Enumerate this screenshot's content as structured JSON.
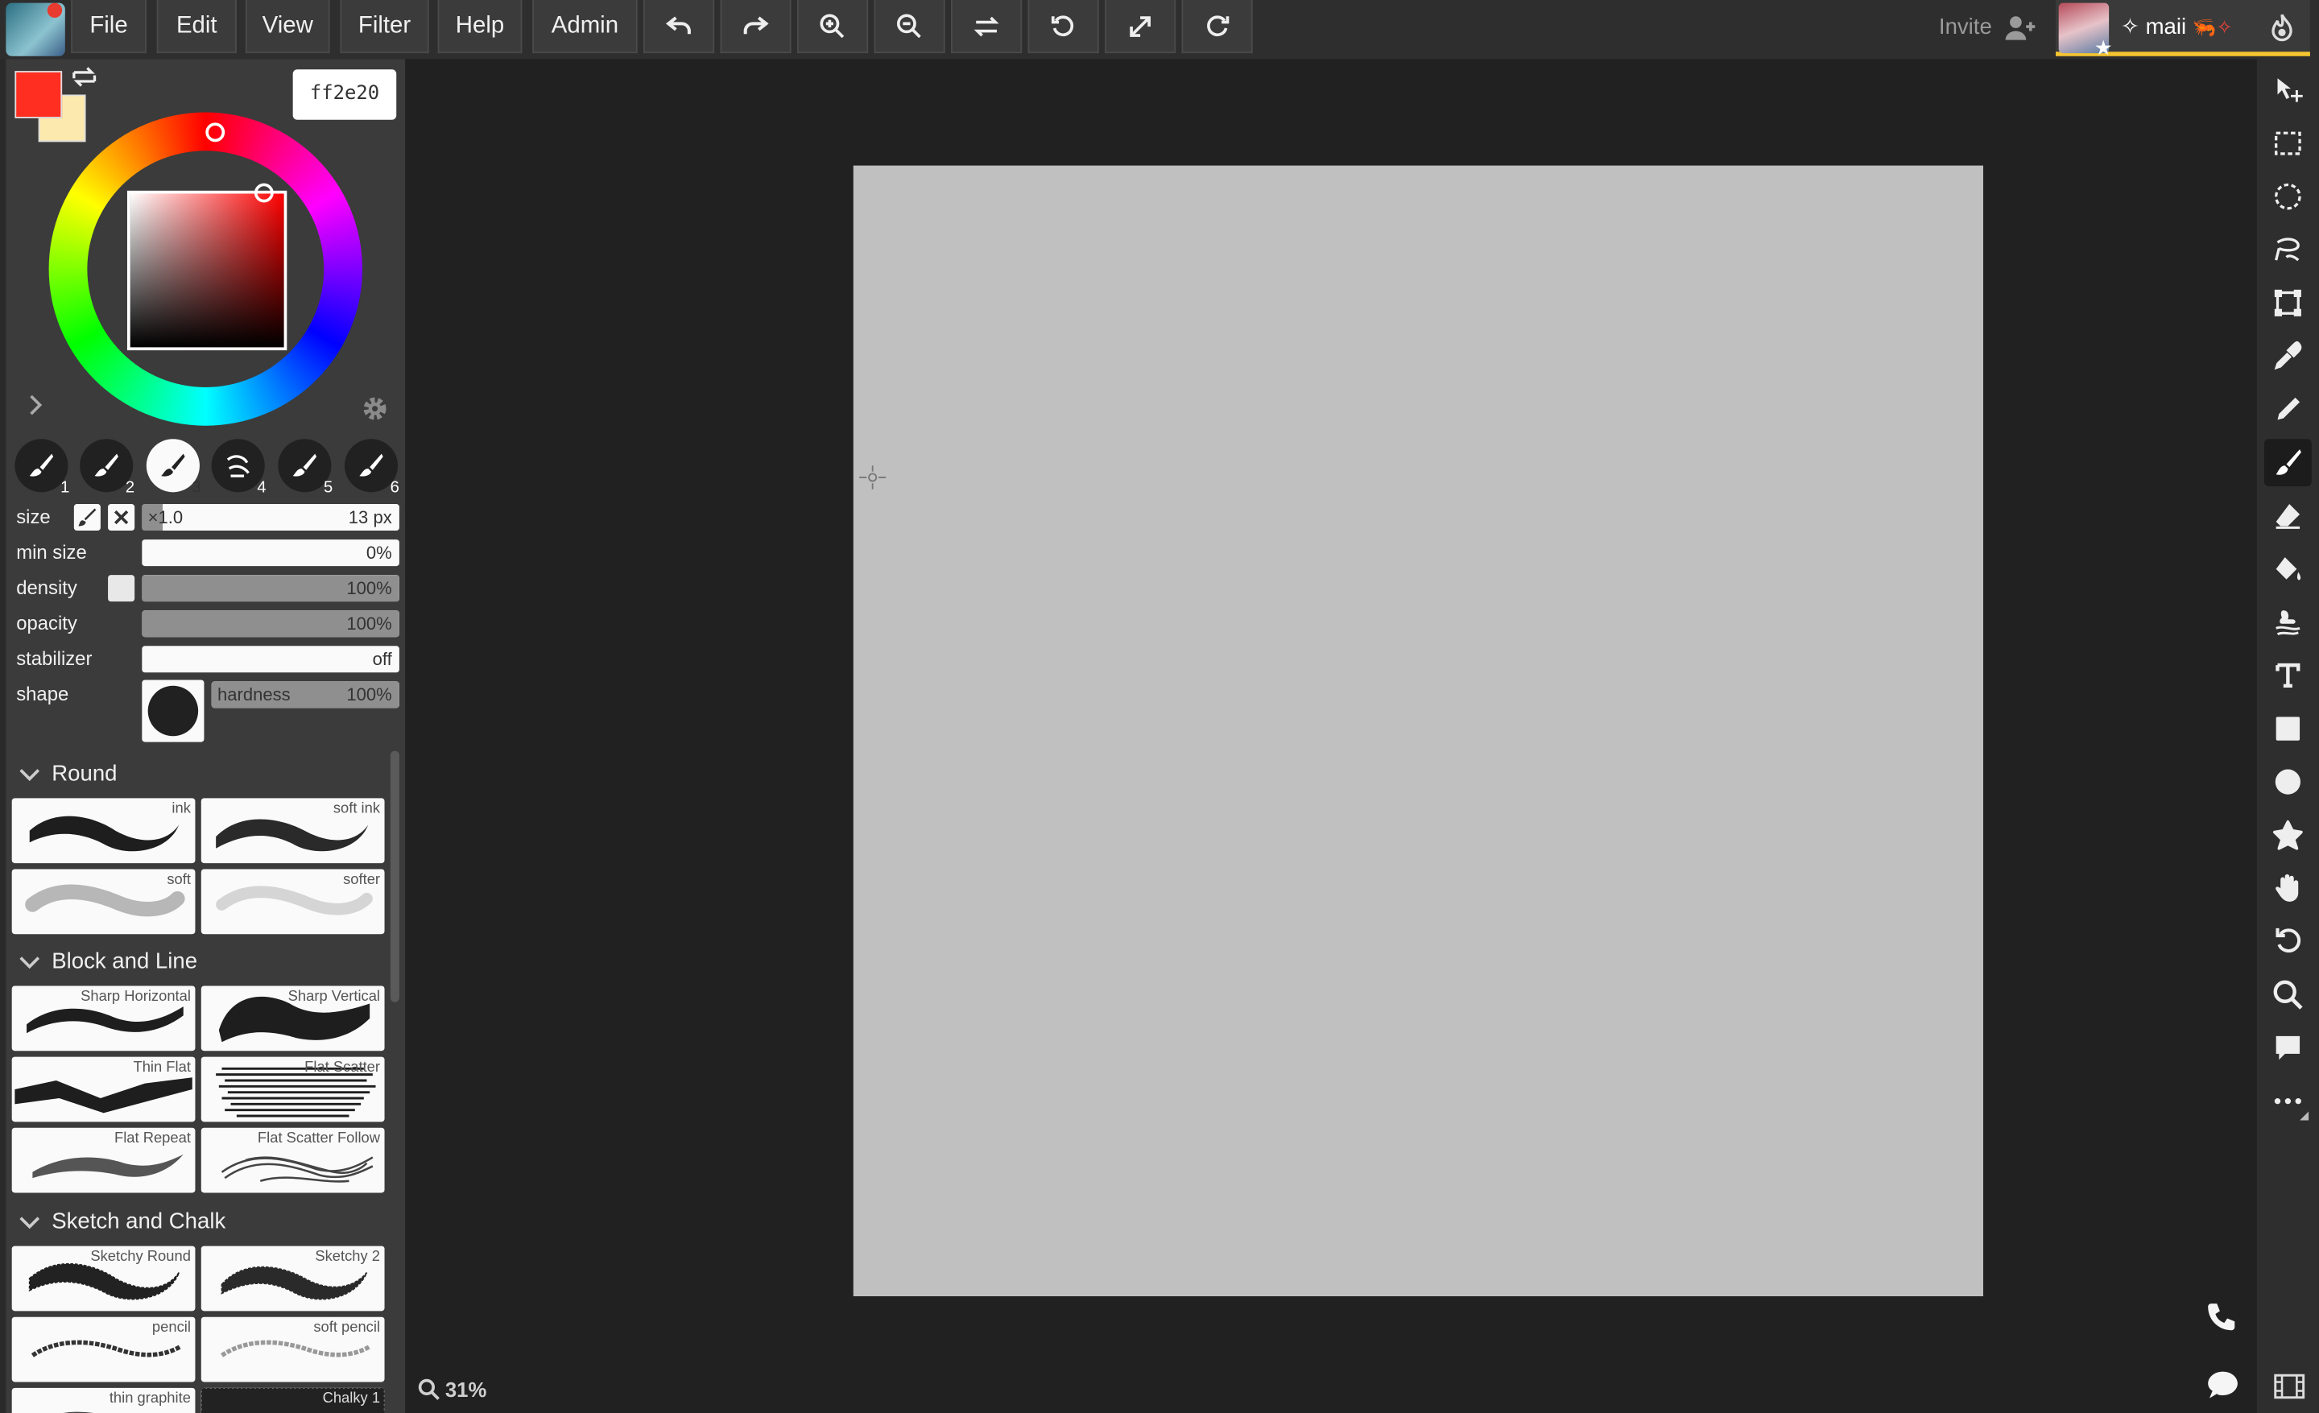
{
  "menu": {
    "file": "File",
    "edit": "Edit",
    "view": "View",
    "filter": "Filter",
    "help": "Help",
    "admin": "Admin"
  },
  "toolbar_icons": [
    "undo-icon",
    "redo-icon",
    "zoom-in-icon",
    "zoom-out-icon",
    "flip-icon",
    "rotate-icon",
    "fullscreen-icon",
    "reset-icon"
  ],
  "header": {
    "invite": "Invite",
    "username": "✧ maii",
    "username_deco": "🦐✧"
  },
  "colors": {
    "primary": "#ff2e20",
    "secondary": "#fbe9ad",
    "hex_value": "ff2e20",
    "accent": "#f4c530"
  },
  "brush_slots": [
    "1",
    "2",
    "3",
    "4",
    "5",
    "6"
  ],
  "active_brush_slot": "3",
  "params": {
    "size_label": "size",
    "size_prefix": "×1.0",
    "size_value": "13 px",
    "min_size_label": "min size",
    "min_size_value": "0%",
    "density_label": "density",
    "density_value": "100%",
    "opacity_label": "opacity",
    "opacity_value": "100%",
    "stabilizer_label": "stabilizer",
    "stabilizer_value": "off",
    "shape_label": "shape",
    "hardness_label": "hardness",
    "hardness_value": "100%"
  },
  "brush_groups": {
    "round": {
      "title": "Round",
      "presets": [
        "ink",
        "soft ink",
        "soft",
        "softer"
      ]
    },
    "block_line": {
      "title": "Block and Line",
      "presets": [
        "Sharp Horizontal",
        "Sharp Vertical",
        "Thin Flat",
        "Flat Scatter",
        "Flat Repeat",
        "Flat Scatter Follow"
      ]
    },
    "sketch_chalk": {
      "title": "Sketch and Chalk",
      "presets": [
        "Sketchy Round",
        "Sketchy 2",
        "pencil",
        "soft pencil",
        "thin graphite",
        "Chalky 1"
      ]
    }
  },
  "footer": {
    "zoom": "31%"
  },
  "right_tools": [
    "move-icon",
    "rect-select-icon",
    "ellipse-select-icon",
    "lasso-icon",
    "transform-icon",
    "eyedropper-icon",
    "pen-icon",
    "brush-icon",
    "eraser-icon",
    "fill-icon",
    "smudge-icon",
    "text-icon",
    "rectangle-icon",
    "ellipse-icon",
    "shape-icon",
    "hand-icon",
    "rotate-view-icon",
    "zoom-icon",
    "comment-icon",
    "more-icon"
  ],
  "active_right_tool": "brush-icon"
}
